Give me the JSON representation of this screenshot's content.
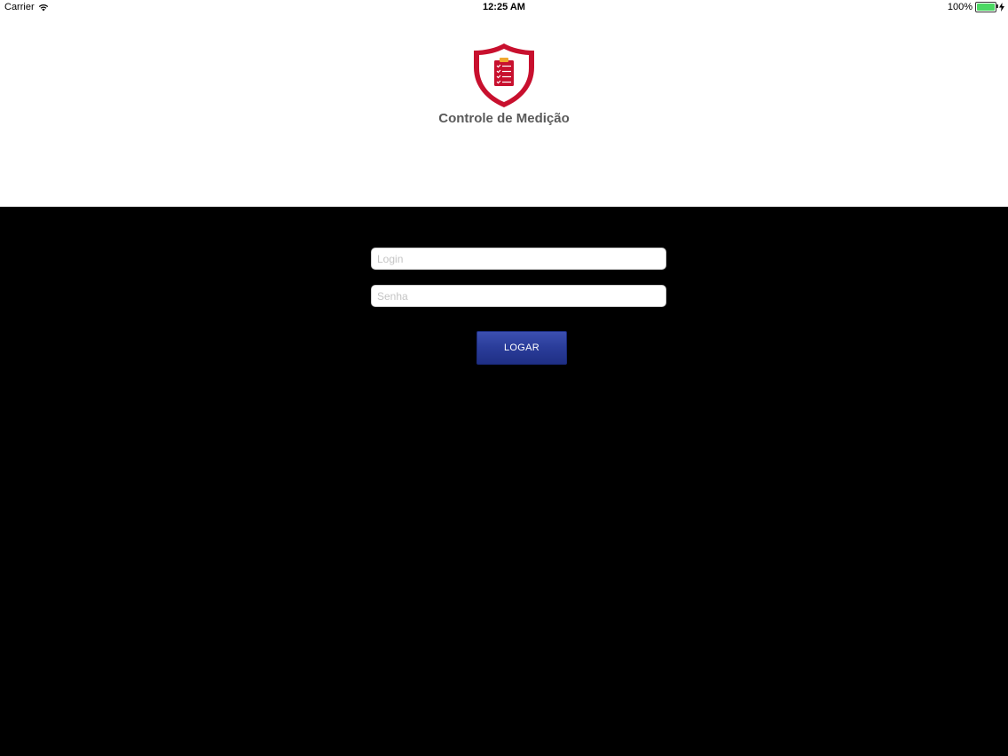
{
  "status_bar": {
    "carrier": "Carrier",
    "time": "12:25 AM",
    "battery": "100%",
    "battery_level": 1.0
  },
  "header": {
    "logo_icon": "shield-clipboard-icon",
    "title": "Controle de Medição"
  },
  "form": {
    "login_placeholder": "Login",
    "login_value": "",
    "password_placeholder": "Senha",
    "password_value": "",
    "submit_label": "LOGAR"
  },
  "colors": {
    "header_background": "#ffffff",
    "body_background": "#000000",
    "logo_red": "#c8102e",
    "logo_accent": "#f0a830",
    "button_blue": "#2a3c99",
    "battery_green": "#4cd964"
  }
}
